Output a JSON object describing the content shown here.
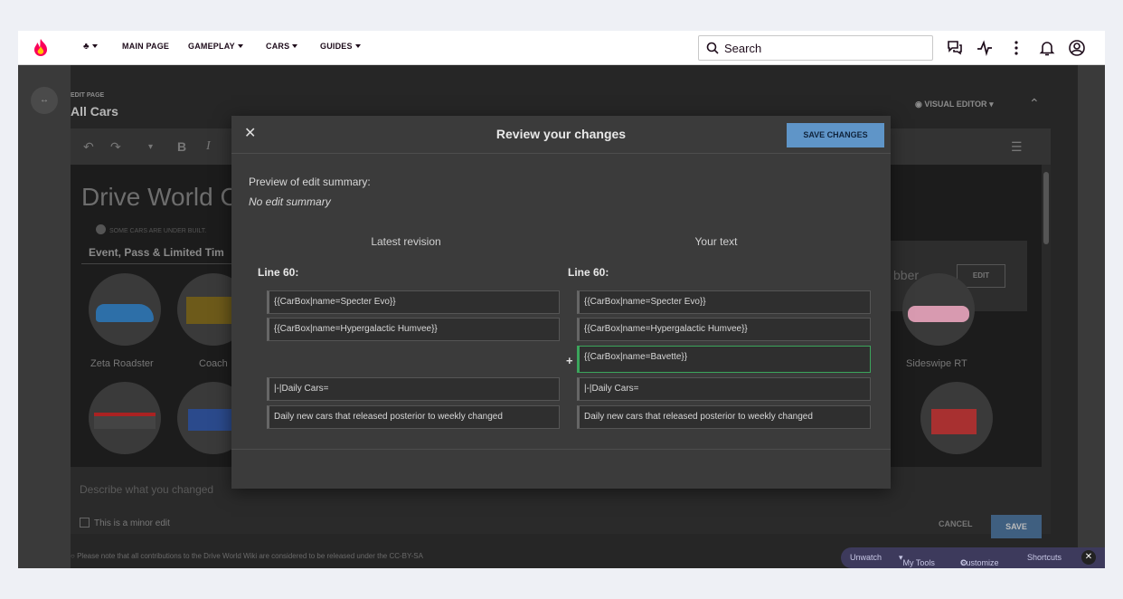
{
  "topnav": {
    "logo_icon": "fandom-flame-icon",
    "items": [
      {
        "label": "",
        "icon": "wiki-menu-icon"
      },
      {
        "label": "MAIN PAGE"
      },
      {
        "label": "GAMEPLAY"
      },
      {
        "label": "CARS"
      },
      {
        "label": "GUIDES"
      }
    ],
    "search_label": "Search",
    "icons": [
      "discussions-icon",
      "activity-icon",
      "more-icon",
      "notifications-icon",
      "account-icon"
    ]
  },
  "editor": {
    "edit_page_label": "EDIT PAGE",
    "page_name": "All Cars",
    "visual_editor_label": "VISUAL EDITOR",
    "page_heading": "Drive World C",
    "notice": "SOME CARS ARE UNDER BUILT.",
    "tab_label": "Event, Pass & Limited Tim",
    "cars": [
      "Zeta Roadster",
      "Coach",
      "Sideswipe RT"
    ],
    "infobox_text": "bber",
    "infobox_edit": "EDIT",
    "summary_placeholder": "Describe what you changed",
    "minor_edit_label": "This is a minor edit",
    "cancel_label": "CANCEL",
    "save_label": "SAVE",
    "footer_note": "Please note that all contributions to the Drive World Wiki are considered to be released under the CC-BY-SA"
  },
  "toolsbar": {
    "unwatch": "Unwatch",
    "my_tools": "My Tools",
    "customize": "Customize",
    "shortcuts": "Shortcuts"
  },
  "modal": {
    "title": "Review your changes",
    "save_button": "SAVE CHANGES",
    "preview_label": "Preview of edit summary:",
    "preview_value": "No edit summary",
    "left_header": "Latest revision",
    "right_header": "Your text",
    "left_line": "Line 60:",
    "right_line": "Line 60:",
    "left_rows": [
      "{{CarBox|name=Specter Evo}}",
      "{{CarBox|name=Hypergalactic Humvee}}",
      "|-|Daily Cars=",
      "Daily new cars that released posterior to weekly changed"
    ],
    "right_rows": [
      "{{CarBox|name=Specter Evo}}",
      "{{CarBox|name=Hypergalactic Humvee}}",
      "{{CarBox|name=Bavette}}",
      "|-|Daily Cars=",
      "Daily new cars that released posterior to weekly changed"
    ],
    "added_marker": "+"
  },
  "colors": {
    "accent": "#5f95c8",
    "added": "#3ba55c",
    "modal_bg": "#3b3b3b"
  }
}
